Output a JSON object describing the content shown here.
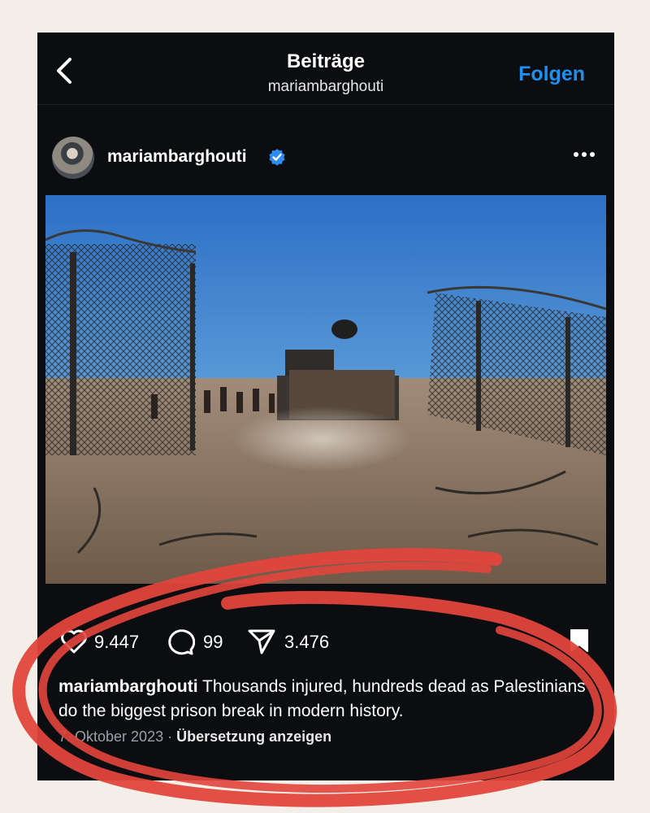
{
  "header": {
    "title": "Beiträge",
    "subtitle": "mariambarghouti",
    "follow_label": "Folgen"
  },
  "post": {
    "username": "mariambarghouti",
    "verified": true,
    "likes": "9.447",
    "comments": "99",
    "shares": "3.476",
    "caption_user": "mariambarghouti",
    "caption_text": " Thousands injured, hundreds dead as Palestinians do the biggest prison break in modern history.",
    "date": "7. Oktober 2023",
    "separator": " · ",
    "translate_label": "Übersetzung anzeigen"
  },
  "icons": {
    "back": "chevron-left-icon",
    "verified": "verified-badge-icon",
    "more": "more-icon",
    "like": "heart-icon",
    "comment": "comment-icon",
    "share": "share-icon",
    "save": "bookmark-icon"
  },
  "colors": {
    "app_background": "#0b0d10",
    "follow_blue": "#1e90f0",
    "annotation_red": "#e2453c",
    "page_background": "#f3eee8"
  }
}
